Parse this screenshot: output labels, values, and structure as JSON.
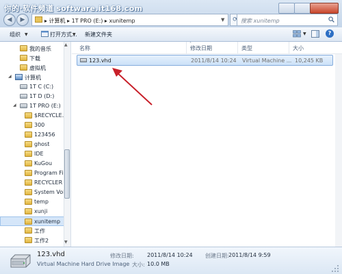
{
  "watermark": "你的·软件频道 software.it168.com",
  "address": {
    "path": "▸ 计算机 ▸ 1T PRO (E:) ▸ xunitemp"
  },
  "search": {
    "placeholder": "搜索 xunitemp"
  },
  "toolbar": {
    "organize": "组织",
    "open_with": "打开方式...",
    "new_folder": "新建文件夹"
  },
  "nav": {
    "items": [
      {
        "label": "我的音乐",
        "icon": "folder-icon"
      },
      {
        "label": "下载",
        "icon": "folder-icon"
      },
      {
        "label": "虚拟机",
        "icon": "folder-icon"
      },
      {
        "label": "计算机",
        "icon": "computer-icon"
      },
      {
        "label": "1T C (C:)",
        "icon": "drive-icon"
      },
      {
        "label": "1T D (D:)",
        "icon": "drive-icon"
      },
      {
        "label": "1T PRO (E:)",
        "icon": "drive-icon"
      },
      {
        "label": "$RECYCLE.BIN",
        "icon": "folder-icon"
      },
      {
        "label": "300",
        "icon": "folder-icon"
      },
      {
        "label": "123456",
        "icon": "folder-icon"
      },
      {
        "label": "ghost",
        "icon": "folder-icon"
      },
      {
        "label": "IDE",
        "icon": "folder-icon"
      },
      {
        "label": "KuGou",
        "icon": "folder-icon"
      },
      {
        "label": "Program Files",
        "icon": "folder-icon"
      },
      {
        "label": "RECYCLER",
        "icon": "folder-icon"
      },
      {
        "label": "System Volume",
        "icon": "folder-icon"
      },
      {
        "label": "temp",
        "icon": "folder-icon"
      },
      {
        "label": "xunji",
        "icon": "folder-icon"
      },
      {
        "label": "xunitemp",
        "icon": "folder-icon"
      },
      {
        "label": "工作",
        "icon": "folder-icon"
      },
      {
        "label": "工作2",
        "icon": "folder-icon"
      }
    ]
  },
  "columns": {
    "name": "名称",
    "date": "修改日期",
    "type": "类型",
    "size": "大小"
  },
  "files": [
    {
      "name": "123.vhd",
      "date": "2011/8/14 10:24",
      "type": "Virtual Machine ...",
      "size": "10,245 KB"
    }
  ],
  "details": {
    "name": "123.vhd",
    "type": "Virtual Machine Hard Drive Image",
    "modified_label": "修改日期:",
    "modified_value": "2011/8/14 10:24",
    "size_label": "大小:",
    "size_value": "10.0 MB",
    "created_label": "创建日期:",
    "created_value": "2011/8/14 9:59"
  },
  "colors": {
    "selection": "#cce1f8",
    "annotation_arrow": "#c8202a",
    "titlebar": "#c5d6ea"
  }
}
